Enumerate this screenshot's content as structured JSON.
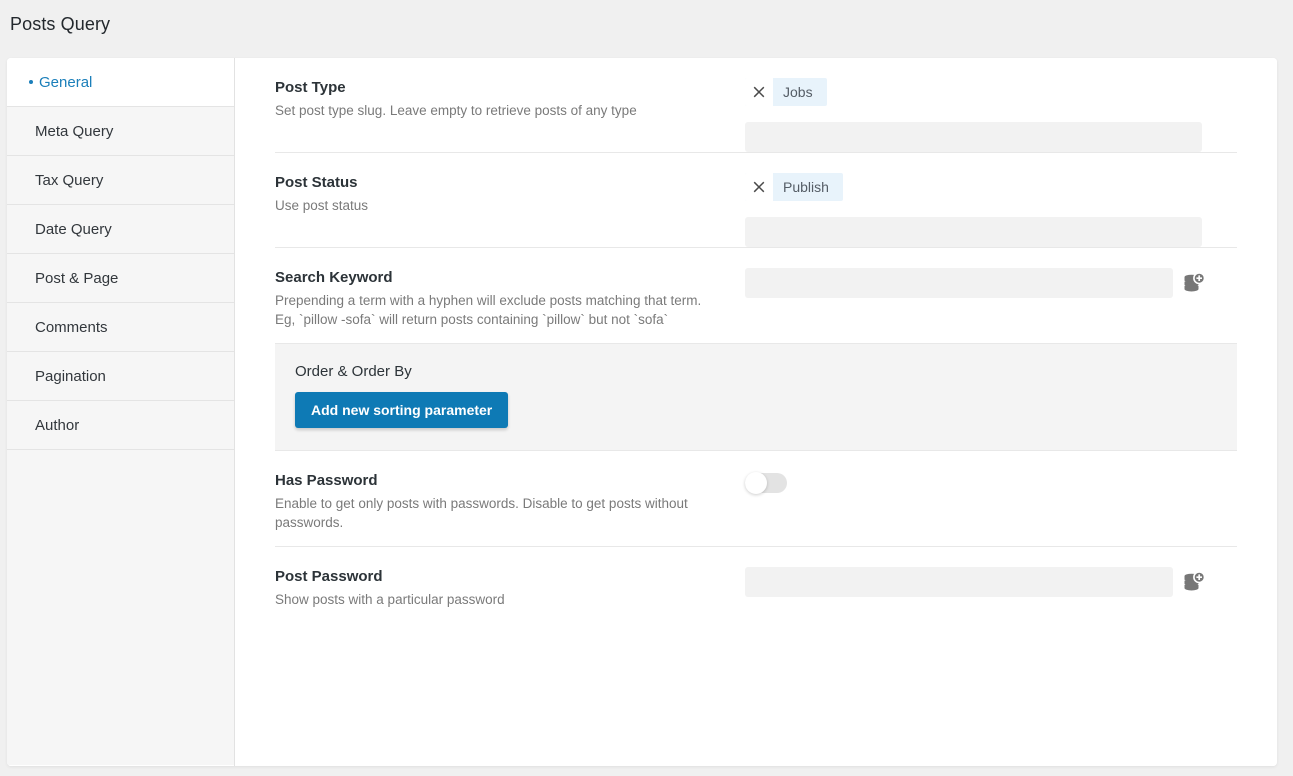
{
  "page": {
    "title": "Posts Query",
    "accent_color": "#1b7fba",
    "button_color": "#0e7ab5",
    "chip_bg": "#e8f3fb",
    "field_bg": "#f2f2f2",
    "panel_bg": "#ffffff",
    "app_bg": "#f0f0f0"
  },
  "sidebar": {
    "items": [
      {
        "label": "General",
        "active": true
      },
      {
        "label": "Meta Query",
        "active": false
      },
      {
        "label": "Tax Query",
        "active": false
      },
      {
        "label": "Date Query",
        "active": false
      },
      {
        "label": "Post & Page",
        "active": false
      },
      {
        "label": "Comments",
        "active": false
      },
      {
        "label": "Pagination",
        "active": false
      },
      {
        "label": "Author",
        "active": false
      }
    ]
  },
  "fields": {
    "post_type": {
      "label": "Post Type",
      "description": "Set post type slug. Leave empty to retrieve posts of any type",
      "chip": {
        "text": "Jobs",
        "remove_icon": "close-icon"
      },
      "input_value": "",
      "input_placeholder": ""
    },
    "post_status": {
      "label": "Post Status",
      "description": "Use post status",
      "chip": {
        "text": "Publish",
        "remove_icon": "close-icon"
      },
      "input_value": "",
      "input_placeholder": ""
    },
    "search_keyword": {
      "label": "Search Keyword",
      "description": "Prepending a term with a hyphen will exclude posts matching that term. Eg, `pillow -sofa` will return posts containing `pillow` but not `sofa`",
      "input_value": "",
      "input_placeholder": "",
      "dynamic_icon": "database-add-icon"
    },
    "order_section": {
      "title": "Order & Order By",
      "add_button_label": "Add new sorting parameter"
    },
    "has_password": {
      "label": "Has Password",
      "description": "Enable to get only posts with passwords. Disable to get posts without passwords.",
      "toggle_state": "off"
    },
    "post_password": {
      "label": "Post Password",
      "description": "Show posts with a particular password",
      "input_value": "",
      "input_placeholder": "",
      "dynamic_icon": "database-add-icon"
    }
  }
}
